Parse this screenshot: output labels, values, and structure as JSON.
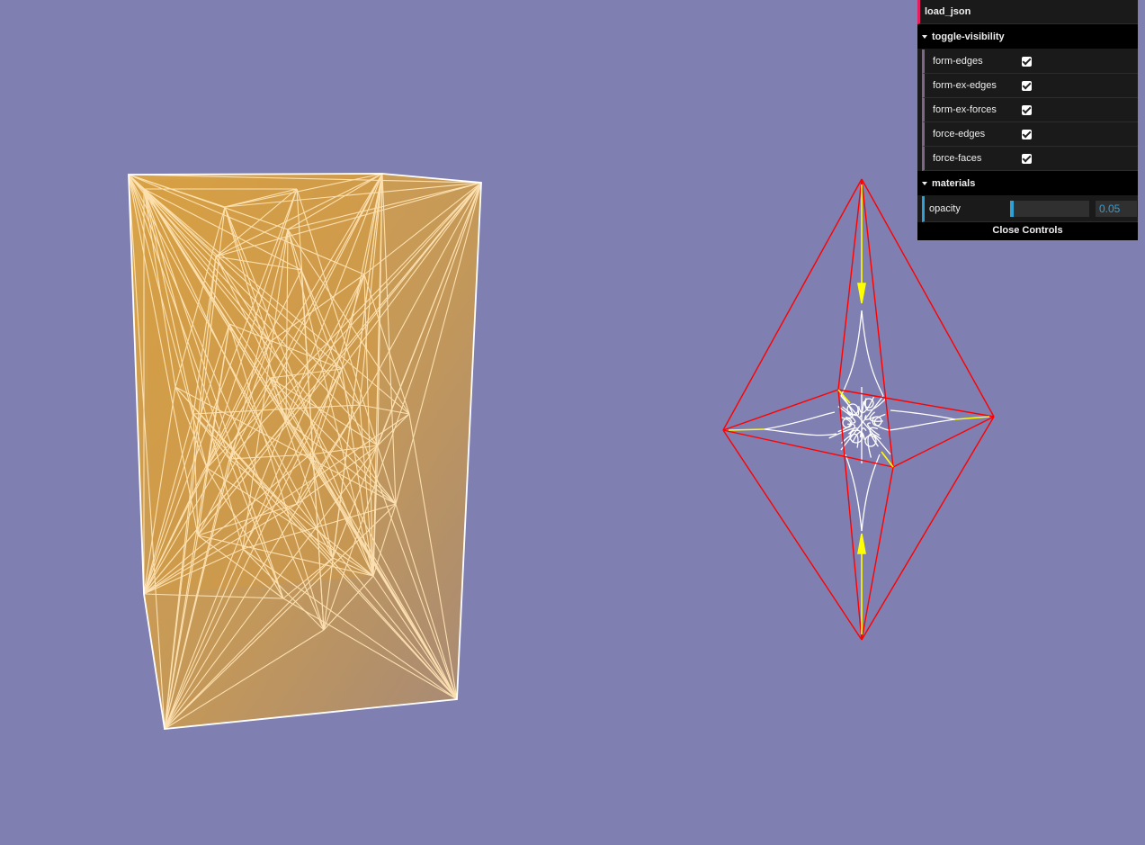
{
  "viewport": {
    "background": "#7f7fb2"
  },
  "gui": {
    "load_json": "load_json",
    "toggle_visibility": {
      "title": "toggle-visibility",
      "items": [
        {
          "label": "form-edges",
          "checked": true
        },
        {
          "label": "form-ex-edges",
          "checked": true
        },
        {
          "label": "form-ex-forces",
          "checked": true
        },
        {
          "label": "force-edges",
          "checked": true
        },
        {
          "label": "force-faces",
          "checked": true
        }
      ]
    },
    "materials": {
      "title": "materials",
      "opacity_label": "opacity",
      "opacity_value": "0.05",
      "opacity_fraction": 0.05
    },
    "close_label": "Close Controls"
  },
  "colors": {
    "form_fill": "#d9a24a",
    "form_edges": "#ffe6b0",
    "force_edges": "#ff0000",
    "force_arrows": "#ffff00",
    "force_web": "#ffffff"
  }
}
